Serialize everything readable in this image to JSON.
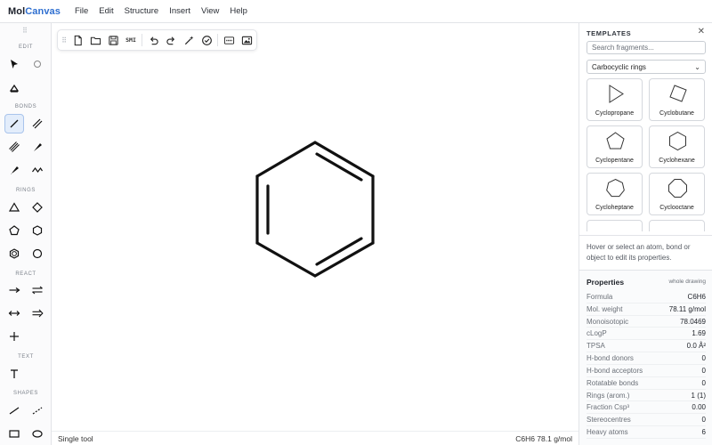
{
  "app": {
    "brand_part1": "Mol",
    "brand_part2": "Canvas"
  },
  "menu": [
    "File",
    "Edit",
    "Structure",
    "Insert",
    "View",
    "Help"
  ],
  "toolbox": {
    "sections": {
      "edit": "EDIT",
      "bonds": "BONDS",
      "rings": "RINGS",
      "react": "REACT",
      "text": "TEXT",
      "shapes": "SHAPES"
    },
    "active_tool": "single-bond-tool"
  },
  "float_toolbar": {
    "smiles_label": "SMI"
  },
  "status": {
    "left": "Single tool",
    "right": "C6H6 78.1 g/mol"
  },
  "templates": {
    "heading": "TEMPLATES",
    "close_icon": "close-icon",
    "search_placeholder": "Search fragments...",
    "category": "Carbocyclic rings",
    "items": [
      "Cyclopropane",
      "Cyclobutane",
      "Cyclopentane",
      "Cyclohexane",
      "Cycloheptane",
      "Cyclooctane"
    ]
  },
  "hint": "Hover or select an atom, bond or object to edit its properties.",
  "properties": {
    "title": "Properties",
    "scope": "whole drawing",
    "rows": [
      {
        "k": "Formula",
        "v": "C6H6"
      },
      {
        "k": "Mol. weight",
        "v": "78.11 g/mol"
      },
      {
        "k": "Monoisotopic",
        "v": "78.0469"
      },
      {
        "k": "cLogP",
        "v": "1.69"
      },
      {
        "k": "TPSA",
        "v": "0.0 Å²"
      },
      {
        "k": "H-bond donors",
        "v": "0"
      },
      {
        "k": "H-bond acceptors",
        "v": "0"
      },
      {
        "k": "Rotatable bonds",
        "v": "0"
      },
      {
        "k": "Rings (arom.)",
        "v": "1 (1)"
      },
      {
        "k": "Fraction Csp³",
        "v": "0.00"
      },
      {
        "k": "Stereocentres",
        "v": "0"
      },
      {
        "k": "Heavy atoms",
        "v": "6"
      }
    ]
  },
  "colors": {
    "accent": "#2f6fd0",
    "active_bg": "#e3edfb",
    "ink": "#111111"
  }
}
